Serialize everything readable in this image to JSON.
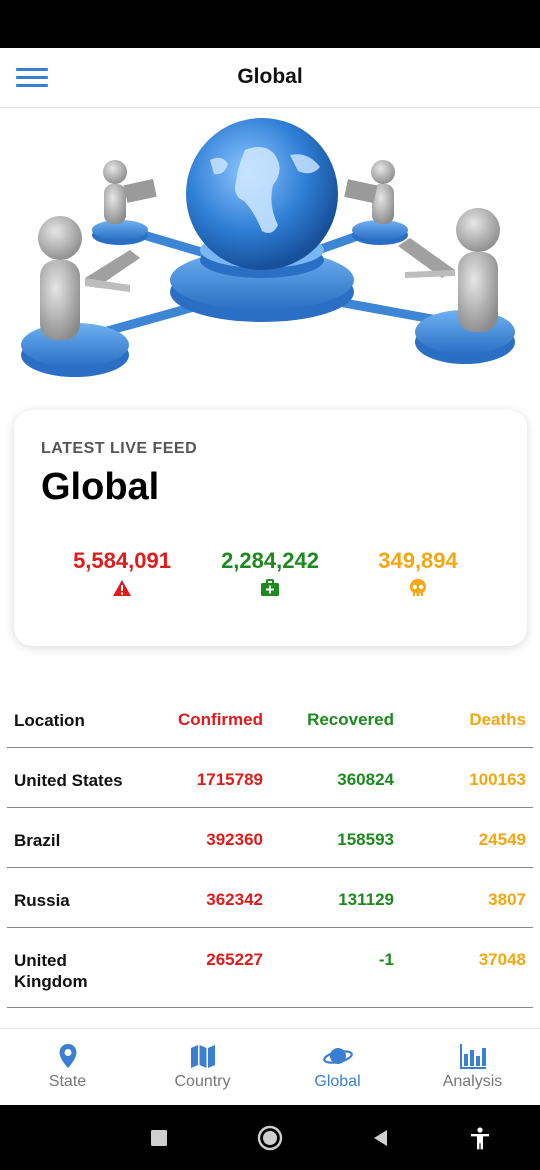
{
  "app_bar": {
    "title": "Global"
  },
  "feed": {
    "label": "LATEST LIVE FEED",
    "title": "Global",
    "confirmed": "5,584,091",
    "recovered": "2,284,242",
    "deaths": "349,894"
  },
  "colors": {
    "confirmed": "#e01b1b",
    "recovered": "#1d8a1d",
    "deaths": "#f3a712",
    "accent": "#3b7fd0"
  },
  "table": {
    "headers": {
      "location": "Location",
      "confirmed": "Confirmed",
      "recovered": "Recovered",
      "deaths": "Deaths"
    },
    "rows": [
      {
        "location": "United States",
        "confirmed": "1715789",
        "recovered": "360824",
        "deaths": "100163"
      },
      {
        "location": "Brazil",
        "confirmed": "392360",
        "recovered": "158593",
        "deaths": "24549"
      },
      {
        "location": "Russia",
        "confirmed": "362342",
        "recovered": "131129",
        "deaths": "3807"
      },
      {
        "location": "United Kingdom",
        "confirmed": "265227",
        "recovered": "-1",
        "deaths": "37048"
      }
    ]
  },
  "bottom_nav": {
    "items": [
      {
        "label": "State",
        "icon": "map-pin-icon"
      },
      {
        "label": "Country",
        "icon": "map-icon"
      },
      {
        "label": "Global",
        "icon": "planet-icon"
      },
      {
        "label": "Analysis",
        "icon": "bar-chart-icon"
      }
    ],
    "active": "Global"
  }
}
